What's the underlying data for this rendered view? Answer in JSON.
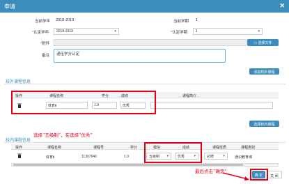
{
  "dialog": {
    "title": "申请",
    "close_glyph": "✕"
  },
  "form": {
    "current_year_label": "当前学年",
    "current_year_value": "2018-2019",
    "current_term_label": "当前学期",
    "current_term_value": "1",
    "confirm_year_label": "认定学年",
    "confirm_year_value": "2018-2019",
    "confirm_term_label": "认定学期",
    "confirm_term_value": "1",
    "required_mark": "*",
    "attachment_label": "附件",
    "choose_file_label": "选择文件",
    "remark_label": "备注",
    "remark_value": "退伍学分认定"
  },
  "outside_section": {
    "add_button": "添加校外课程",
    "title": "校外课程信息",
    "headers": [
      "操作",
      "课程名称",
      "学分",
      "成绩",
      "课程简介"
    ],
    "row": {
      "course_name": "体育Ⅱ",
      "credit": "1.0",
      "grade": "优秀",
      "intro": ""
    },
    "choose_inside_button": "选择校内课程"
  },
  "inside_section": {
    "title": "校内课程信息",
    "headers": [
      "操作",
      "课程名称",
      "课程号",
      "学分",
      "模块",
      "成绩",
      "课程性质",
      "课程类别"
    ],
    "row": {
      "course_name": "体育Ⅱ",
      "course_no": "11307640",
      "credit": "1.0",
      "module": "五级制",
      "grade": "优秀",
      "nature": "必修",
      "category": "通识教育课"
    }
  },
  "annotations": {
    "select_hint": "选择“五级制”，在选择“优秀”",
    "confirm_hint": "最后点击“确定”"
  },
  "footer": {
    "confirm_label": "确 定",
    "close_label": "关 闭"
  },
  "colors": {
    "accent": "#3c8dbc",
    "annotation": "#e60012"
  }
}
